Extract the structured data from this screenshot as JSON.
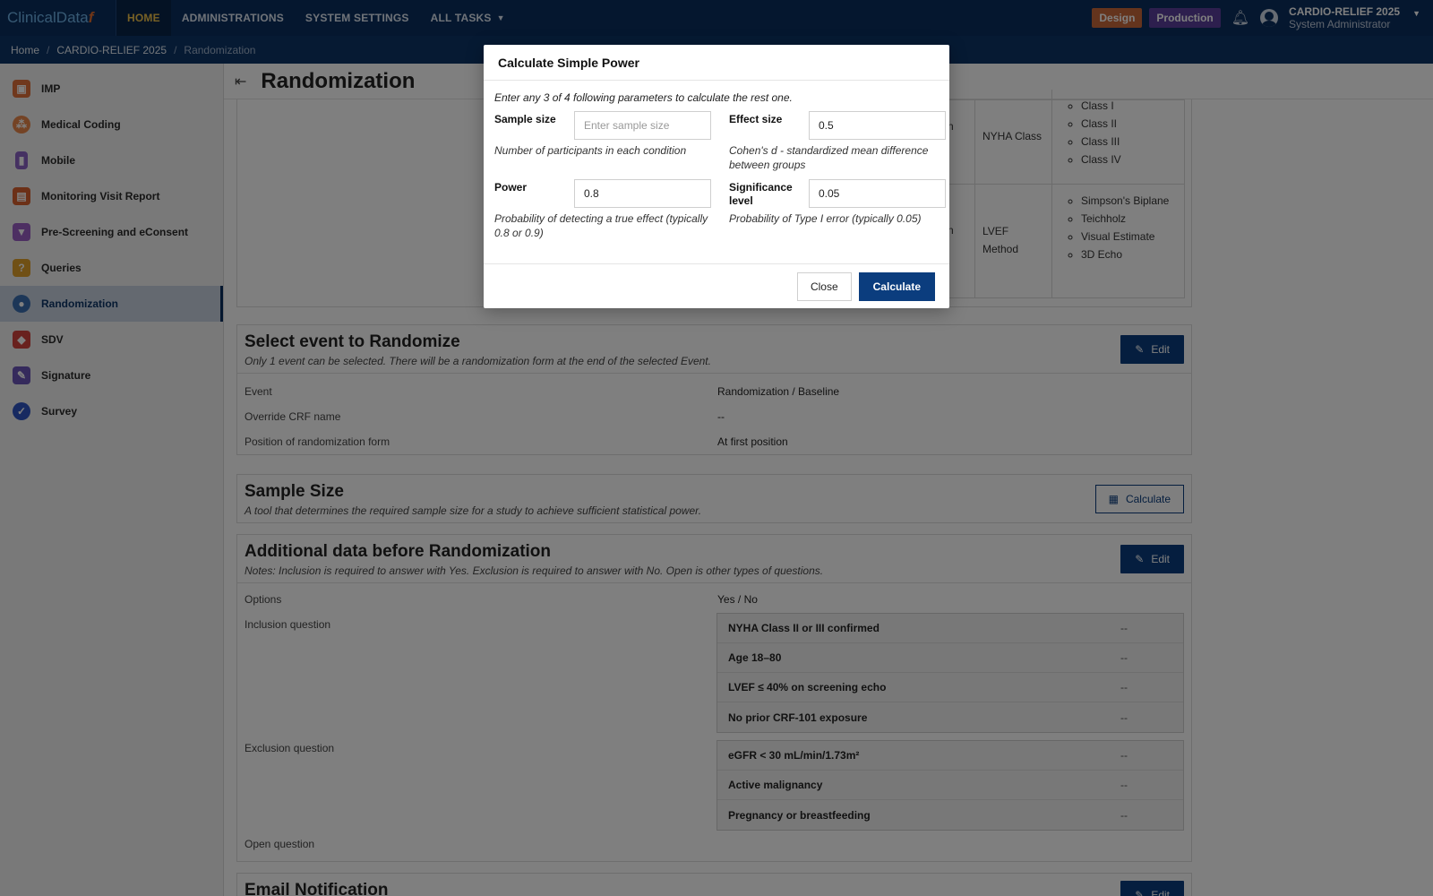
{
  "app": {
    "logo_text": "ClinicalData",
    "logo_mark": "f"
  },
  "topnav": {
    "items": [
      "HOME",
      "ADMINISTRATIONS",
      "SYSTEM SETTINGS",
      "ALL TASKS"
    ]
  },
  "env": {
    "design": "Design",
    "production": "Production"
  },
  "user": {
    "study": "CARDIO-RELIEF 2025",
    "role": "System Administrator"
  },
  "breadcrumb": [
    "Home",
    "CARDIO-RELIEF 2025",
    "Randomization"
  ],
  "sidebar": {
    "items": [
      "IMP",
      "Medical Coding",
      "Mobile",
      "Monitoring Visit Report",
      "Pre-Screening and eConsent",
      "Queries",
      "Randomization",
      "SDV",
      "Signature",
      "Survey"
    ]
  },
  "page": {
    "title": "Randomization"
  },
  "strat": {
    "rows": [
      {
        "a": "enin",
        "b": "NYHA Class",
        "items": [
          "Class I",
          "Class II",
          "Class III",
          "Class IV"
        ]
      },
      {
        "a": "enin",
        "b": "LVEF Method",
        "items": [
          "Simpson's Biplane",
          "Teichholz",
          "Visual Estimate",
          "3D Echo"
        ]
      }
    ]
  },
  "event_card": {
    "title": "Select event to Randomize",
    "subtitle": "Only 1 event can be selected. There will be a randomization form at the end of the selected Event.",
    "edit": "Edit",
    "rows": [
      {
        "k": "Event",
        "v": "Randomization / Baseline"
      },
      {
        "k": "Override CRF name",
        "v": "--"
      },
      {
        "k": "Position of randomization form",
        "v": "At first position"
      }
    ]
  },
  "sample_card": {
    "title": "Sample Size",
    "subtitle": "A tool that determines the required sample size for a study to achieve sufficient statistical power.",
    "calculate": "Calculate"
  },
  "additional_card": {
    "title": "Additional data before Randomization",
    "subtitle": "Notes: Inclusion is required to answer with Yes. Exclusion is required to answer with No. Open is other types of questions.",
    "edit": "Edit",
    "options_label": "Options",
    "options_value": "Yes / No",
    "inclusion_label": "Inclusion question",
    "inclusion": [
      {
        "q": "NYHA Class II or III confirmed",
        "a": "--"
      },
      {
        "q": "Age 18–80",
        "a": "--"
      },
      {
        "q": "LVEF ≤ 40% on screening echo",
        "a": "--"
      },
      {
        "q": "No prior CRF-101 exposure",
        "a": "--"
      }
    ],
    "exclusion_label": "Exclusion question",
    "exclusion": [
      {
        "q": "eGFR < 30 mL/min/1.73m²",
        "a": "--"
      },
      {
        "q": "Active malignancy",
        "a": "--"
      },
      {
        "q": "Pregnancy or breastfeeding",
        "a": "--"
      }
    ],
    "open_label": "Open question"
  },
  "email_card": {
    "title": "Email Notification",
    "edit": "Edit"
  },
  "modal": {
    "title": "Calculate Simple Power",
    "hint": "Enter any 3 of 4 following parameters to calculate the rest one.",
    "sample_size": {
      "label": "Sample size",
      "placeholder": "Enter sample size",
      "value": "",
      "help": "Number of participants in each condition"
    },
    "effect_size": {
      "label": "Effect size",
      "value": "0.5",
      "help": "Cohen's d - standardized mean difference between groups"
    },
    "power": {
      "label": "Power",
      "value": "0.8",
      "help": "Probability of detecting a true effect (typically 0.8 or 0.9)"
    },
    "significance": {
      "label": "Significance level",
      "value": "0.05",
      "help": "Probability of Type I error (typically 0.05)"
    },
    "close": "Close",
    "calculate": "Calculate"
  },
  "colors": {
    "nav_bg": "#0b2f5e",
    "accent": "#0b3d7e",
    "design_badge": "#c9683a",
    "production_badge": "#5a3f9c",
    "active_nav": "#f0c24b"
  },
  "icons": {
    "sidebar": [
      "cube-icon",
      "molecule-icon",
      "phone-icon",
      "report-icon",
      "funnel-icon",
      "question-icon",
      "shuffle-icon",
      "shield-icon",
      "pen-icon",
      "badge-icon"
    ]
  }
}
